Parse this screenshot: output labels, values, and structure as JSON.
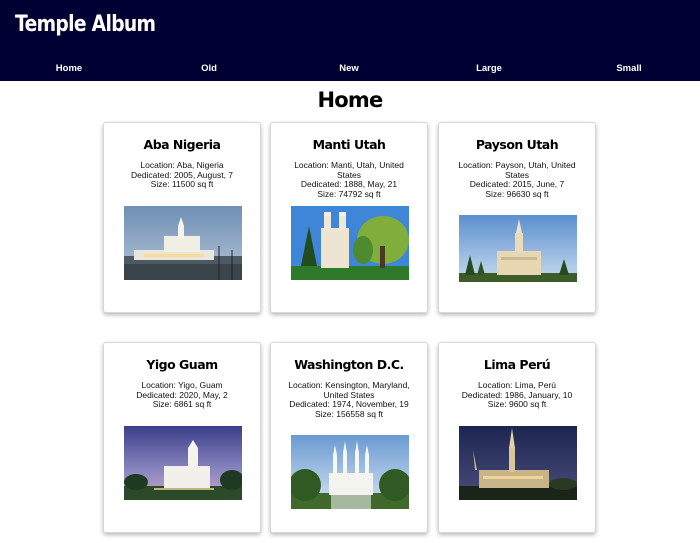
{
  "header": {
    "title": "Temple Album"
  },
  "nav": [
    {
      "label": "Home"
    },
    {
      "label": "Old"
    },
    {
      "label": "New"
    },
    {
      "label": "Large"
    },
    {
      "label": "Small"
    }
  ],
  "page": {
    "heading": "Home"
  },
  "temples": [
    {
      "name": "Aba Nigeria",
      "location": "Location: Aba, Nigeria",
      "dedicated": "Dedicated: 2005, August, 7",
      "size": "Size: 11500 sq ft"
    },
    {
      "name": "Manti Utah",
      "location": "Location: Manti, Utah, United States",
      "dedicated": "Dedicated: 1888, May, 21",
      "size": "Size: 74792 sq ft"
    },
    {
      "name": "Payson Utah",
      "location": "Location: Payson, Utah, United States",
      "dedicated": "Dedicated: 2015, June, 7",
      "size": "Size: 96630 sq ft"
    },
    {
      "name": "Yigo Guam",
      "location": "Location: Yigo, Guam",
      "dedicated": "Dedicated: 2020, May, 2",
      "size": "Size: 6861 sq ft"
    },
    {
      "name": "Washington D.C.",
      "location": "Location: Kensington, Maryland, United States",
      "dedicated": "Dedicated: 1974, November, 19",
      "size": "Size: 156558 sq ft"
    },
    {
      "name": "Lima Perú",
      "location": "Location: Lima, Perú",
      "dedicated": "Dedicated: 1986, January, 10",
      "size": "Size: 9600 sq ft"
    }
  ],
  "colors": {
    "header_bg": "#000033",
    "nav_text": "#ffffff"
  }
}
